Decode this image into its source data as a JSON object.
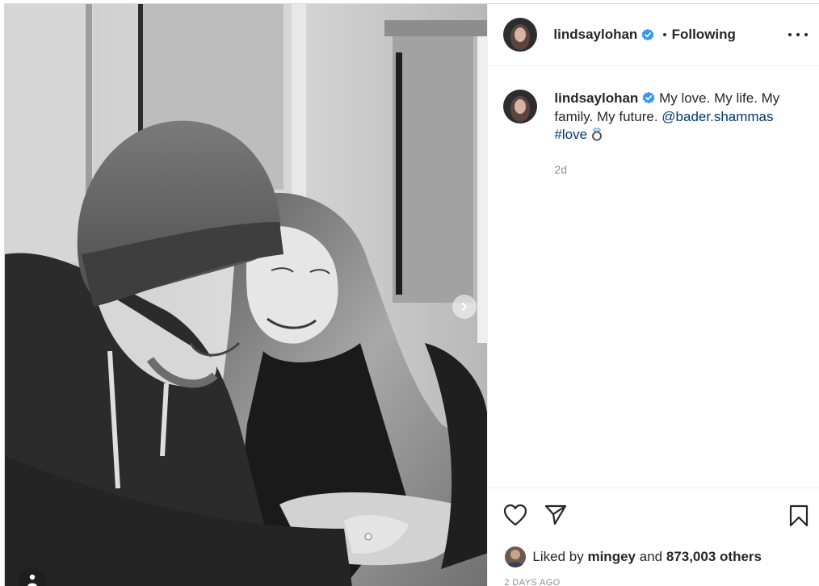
{
  "post": {
    "username": "lindsaylohan",
    "follow_separator": "•",
    "follow_state": "Following",
    "caption": {
      "username": "lindsaylohan",
      "text": "My love. My life. My family. My future.",
      "mention": "@bader.shammas",
      "hashtag": "#love",
      "emoji": "💍",
      "time_ago": "2d"
    },
    "likes": {
      "prefix": "Liked by",
      "first_liker": "mingey",
      "joiner": "and",
      "count_text": "873,003 others"
    },
    "timestamp": "2 DAYS AGO"
  },
  "icons": {
    "verified": "verified-badge-icon",
    "more": "more-options-icon",
    "next": "chevron-right-icon",
    "like": "heart-icon",
    "share": "paper-plane-icon",
    "save": "bookmark-icon",
    "tags": "user-tag-icon"
  },
  "colors": {
    "verified_blue": "#3897f0",
    "link": "#00376b",
    "muted": "#8e8e8e",
    "text": "#262626"
  }
}
